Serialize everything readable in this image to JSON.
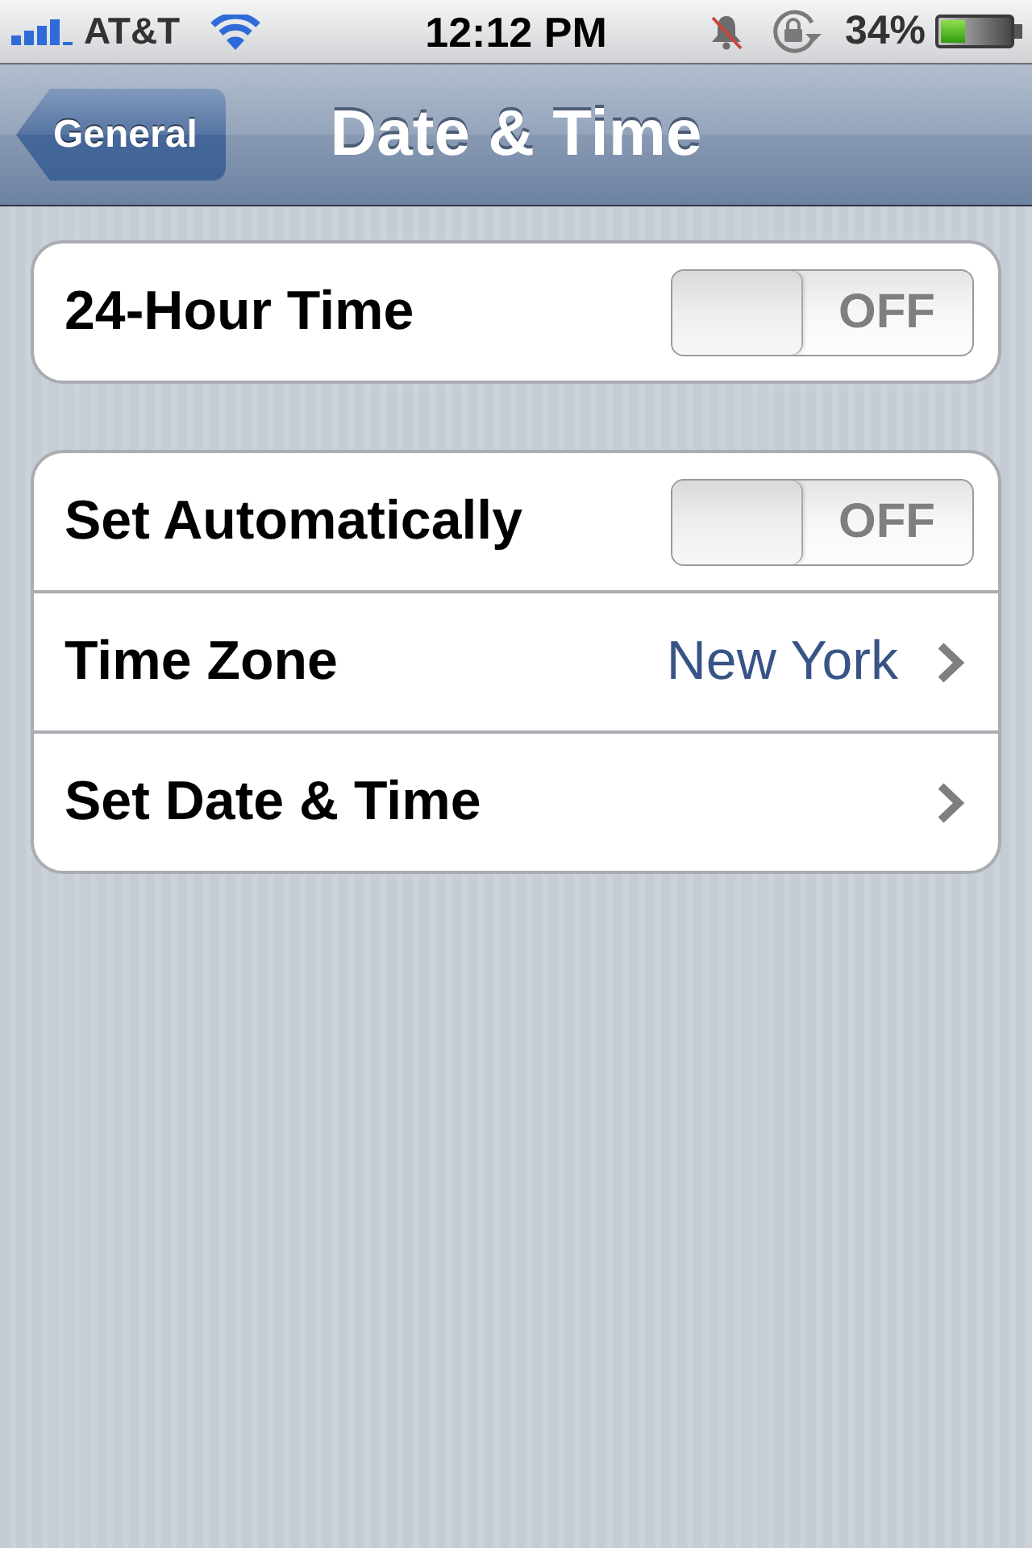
{
  "status_bar": {
    "carrier": "AT&T",
    "time": "12:12 PM",
    "battery": "34%"
  },
  "nav_bar": {
    "back_button": "General",
    "title": "Date & Time"
  },
  "groups": [
    {
      "rows": [
        {
          "kind": "toggle",
          "label": "24-Hour Time",
          "on": false,
          "switch_text": "OFF"
        }
      ]
    },
    {
      "rows": [
        {
          "kind": "toggle",
          "label": "Set Automatically",
          "on": false,
          "switch_text": "OFF"
        },
        {
          "kind": "disclosure",
          "label": "Time Zone",
          "value": "New York"
        },
        {
          "kind": "disclosure",
          "label": "Set Date & Time"
        }
      ]
    }
  ]
}
